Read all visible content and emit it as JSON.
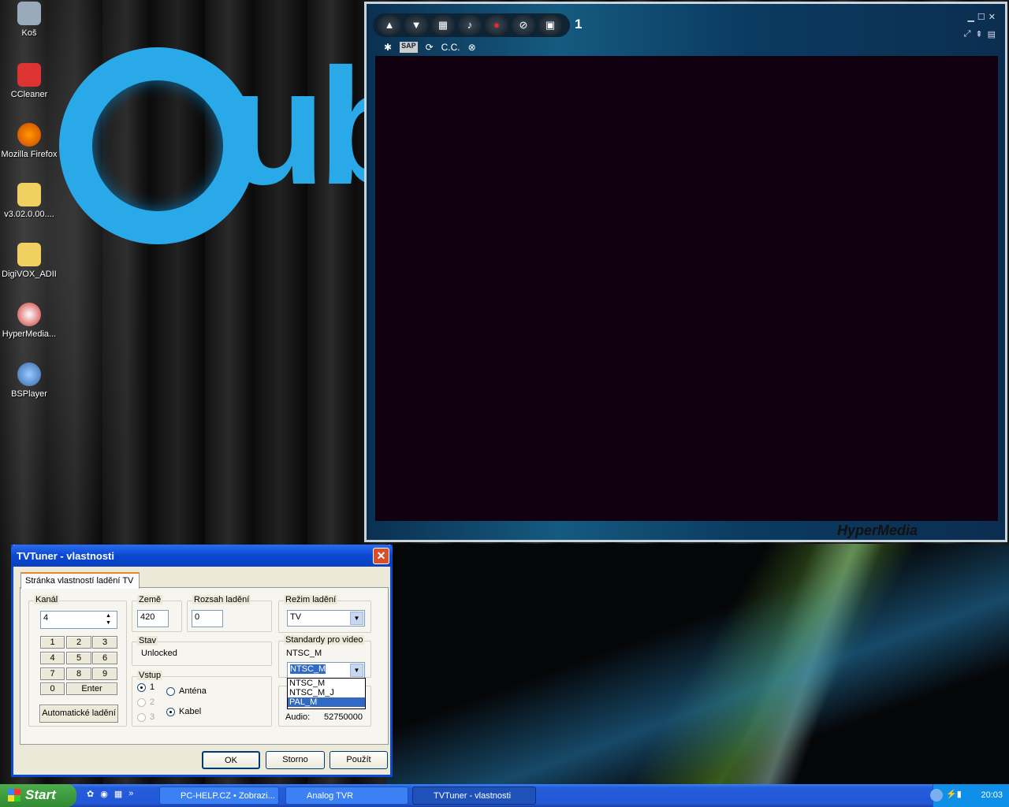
{
  "desktop": {
    "icons": [
      {
        "label": "Koš"
      },
      {
        "label": "CCleaner"
      },
      {
        "label": "Mozilla Firefox"
      },
      {
        "label": "v3.02.0.00...."
      },
      {
        "label": "DigiVOX_ADII"
      },
      {
        "label": "HyperMedia..."
      },
      {
        "label": "BSPlayer"
      }
    ],
    "wallpaper_text": "ub"
  },
  "player": {
    "channel": "1",
    "sap": "SAP",
    "cc": "C.C.",
    "brand": "HyperMedia",
    "toolbar_icons": [
      "arrow-up-icon",
      "arrow-down-icon",
      "grid-icon",
      "music-note-icon",
      "record-icon",
      "schedule-icon",
      "snapshot-icon"
    ]
  },
  "dialog": {
    "title": "TVTuner - vlastnosti",
    "close": "✕",
    "tab": "Stránka vlastností ladění TV",
    "kanal": {
      "label": "Kanál",
      "value": "4",
      "keys": [
        "1",
        "2",
        "3",
        "4",
        "5",
        "6",
        "7",
        "8",
        "9",
        "0",
        "Enter"
      ],
      "auto": "Automatické ladění"
    },
    "zeme": {
      "label": "Země",
      "value": "420"
    },
    "rozsah": {
      "label": "Rozsah ladění",
      "value": "0"
    },
    "rezim": {
      "label": "Režim ladění",
      "value": "TV"
    },
    "stav": {
      "label": "Stav",
      "value": "Unlocked"
    },
    "vstup": {
      "label": "Vstup",
      "inputs": [
        "1",
        "2",
        "3"
      ],
      "antena": "Anténa",
      "kabel": "Kabel"
    },
    "standardy": {
      "label": "Standardy pro video",
      "current": "NTSC_M",
      "selected": "NTSC_M",
      "options": [
        "NTSC_M",
        "NTSC_M_J",
        "PAL_M"
      ]
    },
    "audio": {
      "label": "Audio:",
      "value": "52750000"
    },
    "buttons": {
      "ok": "OK",
      "storno": "Storno",
      "pouzit": "Použít"
    }
  },
  "taskbar": {
    "start": "Start",
    "tasks": [
      "PC-HELP.CZ • Zobrazi...",
      "Analog TVR",
      "TVTuner - vlastnosti"
    ],
    "clock": "20:03"
  }
}
